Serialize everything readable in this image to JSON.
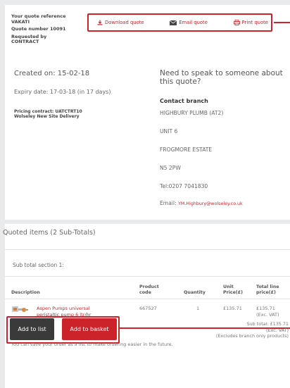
{
  "quote": {
    "ref_label": "Your quote reference",
    "ref_value": "VAKATI",
    "number": "Quote number 10091",
    "requested_label": "Requested by",
    "requested_value": "CONTRACT"
  },
  "actions": {
    "download": "Download quote",
    "email": "Email quote",
    "print": "Print quote",
    "accent_color": "#cc2229"
  },
  "dates": {
    "created": "Created on: 15-02-18",
    "expiry": "Expiry date: 17-03-18 (in 17 days)"
  },
  "pricing": {
    "contract": "Pricing contract: UATCTRT10",
    "delivery": "Wolseley New Site Delivery"
  },
  "contact": {
    "heading": "Need to speak to someone about this quote?",
    "branch_title": "Contact branch",
    "lines": [
      "HIGHBURY PLUMB (AT2)",
      "UNIT 6",
      "FROGMORE ESTATE",
      "N5 2PW",
      "Tel:0207 7041830"
    ],
    "email_label": "Email:",
    "email": "YM.Highbury@wolseley.co.uk"
  },
  "items": {
    "title": "Quoted items (2 Sub-Totals)",
    "section_title": "Sub total section 1:",
    "headers": {
      "description": "Description",
      "code_line1": "Product",
      "code_line2": "code",
      "quantity": "Quantity",
      "unit_line1": "Unit",
      "unit_line2": "Price(£)",
      "total_line1": "Total line",
      "total_line2": "price(£)"
    },
    "rows": [
      {
        "desc_line1": "Aspen Pumps universal",
        "desc_line2": "peristaltic pump 6 ltr/hr",
        "code": "667527",
        "quantity": "1",
        "unit_price": "£135.71",
        "total": "£135.71",
        "total_note": "(Exc. VAT)"
      }
    ]
  },
  "buttons": {
    "add_to_list": "Add to list",
    "add_to_basket": "Add to basket"
  },
  "summary": {
    "subtotal": "Sub total: £135.71",
    "vat_note": "(Exc. VAT)",
    "branch_note": "(Excludes branch only products)",
    "save_note": "You can save your order as a list to make ordering easier in the future."
  }
}
